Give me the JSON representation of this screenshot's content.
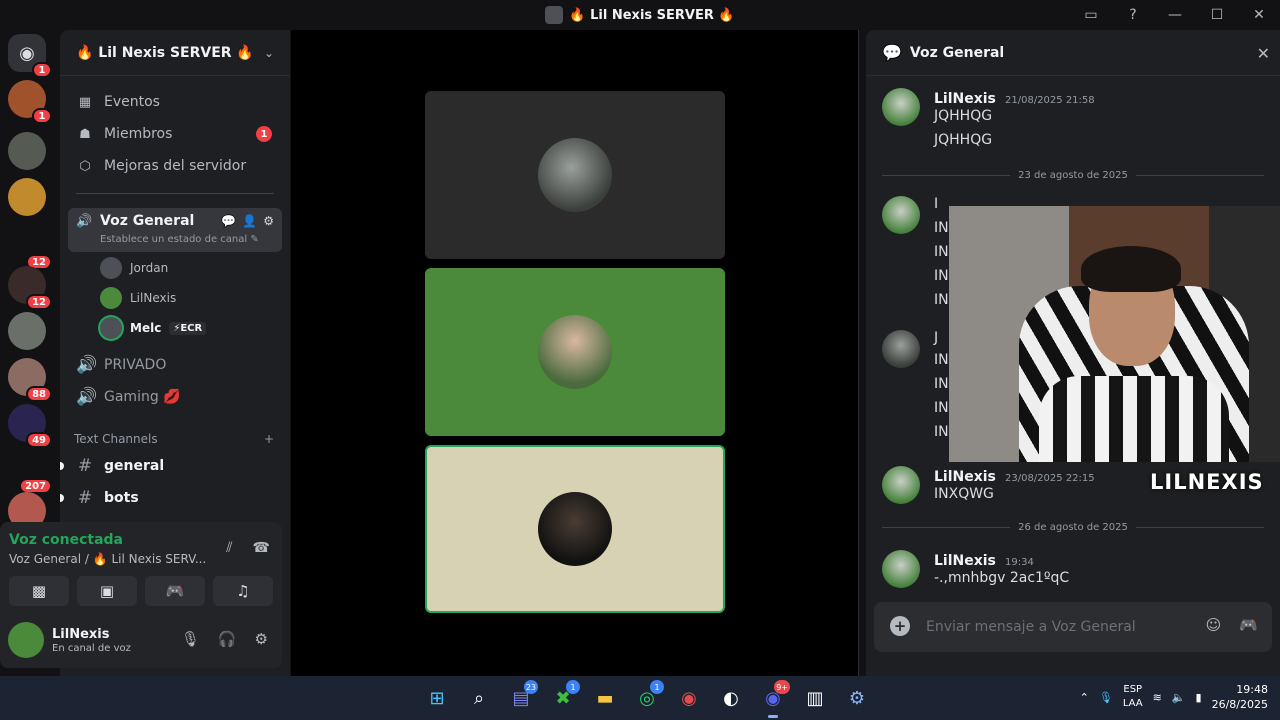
{
  "window": {
    "title": "🔥 Lil Nexis SERVER 🔥",
    "controls": {
      "inbox": "▭",
      "help": "?",
      "minimize": "—",
      "maximize": "☐",
      "close": "✕"
    }
  },
  "rail": {
    "servers": [
      {
        "name": "direct-messages",
        "badge": "1"
      },
      {
        "name": "server-1",
        "badge": "1"
      },
      {
        "name": "server-2",
        "badge": ""
      },
      {
        "name": "server-3",
        "badge": ""
      },
      {
        "name": "server-4",
        "badge": "12"
      },
      {
        "name": "server-5",
        "badge": "12"
      },
      {
        "name": "server-6",
        "badge": ""
      },
      {
        "name": "server-7",
        "badge": "88"
      },
      {
        "name": "server-8",
        "badge": "49"
      },
      {
        "name": "server-9",
        "badge": "207"
      },
      {
        "name": "server-10",
        "badge": ""
      }
    ]
  },
  "sidebar": {
    "guild_name": "🔥 Lil Nexis SERVER 🔥",
    "menu": [
      {
        "label": "Eventos",
        "icon": "calendar-icon",
        "badge": ""
      },
      {
        "label": "Miembros",
        "icon": "members-icon",
        "badge": "1"
      },
      {
        "label": "Mejoras del servidor",
        "icon": "boost-icon",
        "badge": ""
      }
    ],
    "voice_channel": {
      "name": "Voz General",
      "status_hint": "Establece un estado de canal ✎",
      "users": [
        {
          "name": "Jordan",
          "tag": ""
        },
        {
          "name": "LilNexis",
          "tag": ""
        },
        {
          "name": "Melc",
          "tag": "⚡ECR"
        }
      ]
    },
    "channels": [
      {
        "name": "PRIVADO",
        "type": "voice"
      },
      {
        "name": "Gaming 💋",
        "type": "voice"
      }
    ],
    "category": "Text Channels",
    "category_add": "+",
    "text_channels": [
      {
        "name": "general"
      },
      {
        "name": "bots"
      }
    ]
  },
  "voice_panel": {
    "status": "Voz conectada",
    "location": "Voz General / 🔥 Lil Nexis SERV..."
  },
  "user_panel": {
    "username": "LilNexis",
    "status": "En canal de voz"
  },
  "chat": {
    "title": "Voz General",
    "messages": [
      {
        "author": "LilNexis",
        "time": "21/08/2025 21:58",
        "lines": [
          "JQHHQG",
          "JQHHQG"
        ]
      },
      {
        "author": "LilNexis",
        "time": "23/08/2025 22:15",
        "lines": [
          "INXQWG"
        ]
      },
      {
        "author": "LilNexis",
        "time": "19:34",
        "lines": [
          "-.,mnhbgv 2ac1ºqC"
        ]
      }
    ],
    "date_separators": [
      "23 de agosto de 2025",
      "26 de agosto de 2025"
    ],
    "partial_lines": [
      "I",
      "IN",
      "IN",
      "IN",
      "IN",
      "J",
      "IN",
      "IN",
      "IN",
      "IN"
    ],
    "composer_placeholder": "Enviar mensaje a Voz General"
  },
  "overlay": {
    "cam_label": "LILNEXIS"
  },
  "taskbar": {
    "badges": {
      "teams": "23",
      "xbox": "1",
      "whatsapp": "1",
      "discord": "9+"
    },
    "language_top": "ESP",
    "language_bottom": "LAA",
    "time": "19:48",
    "date": "26/8/2025"
  },
  "colors": {
    "accent_green": "#23a55a",
    "badge_red": "#f23f43",
    "tile_green": "#4a8a3a",
    "tile_beige": "#d8d2b5"
  }
}
